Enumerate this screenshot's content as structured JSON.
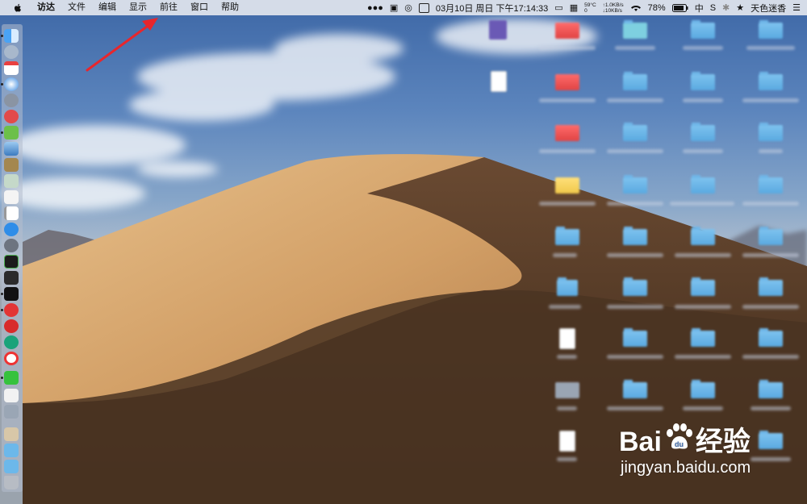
{
  "menubar": {
    "apple_icon": "apple-logo-icon",
    "app_name": "访达",
    "menus": [
      "文件",
      "编辑",
      "显示",
      "前往",
      "窗口",
      "帮助"
    ],
    "status": {
      "datetime": "03月10日 周日 下午17:14:33",
      "temp": "59°C",
      "rpm": "0",
      "net_up": "↑1.0KB/s",
      "net_down": "↓10KB/s",
      "battery": "78%",
      "input_method": "中",
      "s_icon": "S",
      "user": "天色迷香"
    }
  },
  "watermark": {
    "logo_text_1": "Bai",
    "logo_text_2": "经验",
    "url": "jingyan.baidu.com"
  },
  "colors": {
    "arrow": "#e8262c",
    "folder": "#6cb8ea"
  }
}
